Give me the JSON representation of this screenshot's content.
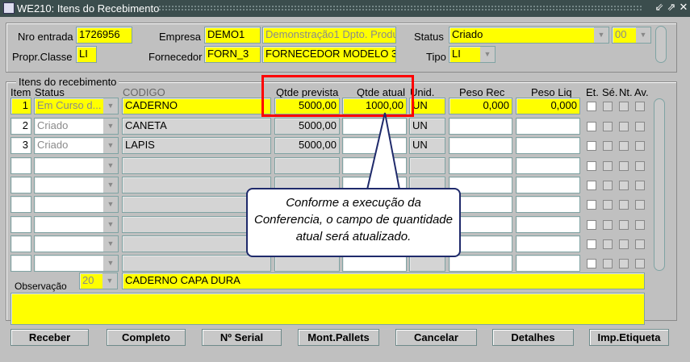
{
  "window": {
    "title": "WE210: Itens do Recebimento",
    "icon": "oracle-forms-icon",
    "controls": [
      "minimize",
      "maximize",
      "close"
    ]
  },
  "header": {
    "nro_entrada_label": "Nro entrada",
    "nro_entrada": "1726956",
    "empresa_label": "Empresa",
    "empresa_code": "DEMO1",
    "empresa_name": "Demonstração1 Dpto. Produ",
    "status_label": "Status",
    "status": "Criado",
    "status_code": "00",
    "propr_classe_label": "Propr.Classe",
    "propr_classe": "LI",
    "fornecedor_label": "Fornecedor",
    "fornecedor_code": "FORN_3",
    "fornecedor_name": "FORNECEDOR MODELO 3",
    "tipo_label": "Tipo",
    "tipo": "LI"
  },
  "items": {
    "frame_title": "Itens do recebimento",
    "columns": {
      "item": "Item",
      "status": "Status",
      "codigo": "CODIGO",
      "qtde_prevista": "Qtde prevista",
      "qtde_atual": "Qtde atual",
      "unid": "Unid.",
      "peso_rec": "Peso Rec",
      "peso_liq": "Peso Liq",
      "et": "Et.",
      "se": "Sé.",
      "nt": "Nt.",
      "av": "Av."
    },
    "rows": [
      {
        "item": "1",
        "status": "Em Curso d...",
        "codigo": "CADERNO",
        "qtde_prevista": "5000,00",
        "qtde_atual": "1000,00",
        "unid": "UN",
        "peso_rec": "0,000",
        "peso_liq": "0,000"
      },
      {
        "item": "2",
        "status": "Criado",
        "codigo": "CANETA",
        "qtde_prevista": "5000,00",
        "qtde_atual": "",
        "unid": "UN",
        "peso_rec": "",
        "peso_liq": ""
      },
      {
        "item": "3",
        "status": "Criado",
        "codigo": "LAPIS",
        "qtde_prevista": "5000,00",
        "qtde_atual": "",
        "unid": "UN",
        "peso_rec": "",
        "peso_liq": ""
      },
      {},
      {},
      {},
      {},
      {},
      {}
    ]
  },
  "observacao": {
    "label": "Observação",
    "code": "20",
    "text": "CADERNO CAPA DURA",
    "detail": ""
  },
  "buttons": [
    "Receber",
    "Completo",
    "Nº Serial",
    "Mont.Pallets",
    "Cancelar",
    "Detalhes",
    "Imp.Etiqueta"
  ],
  "callout": {
    "text": "Conforme a execução da Conferencia, o campo de quantidade atual será atualizado."
  },
  "colors": {
    "field": "#ffff00",
    "highlight": "#ff0000",
    "titlebar": "#3b4d4d"
  }
}
